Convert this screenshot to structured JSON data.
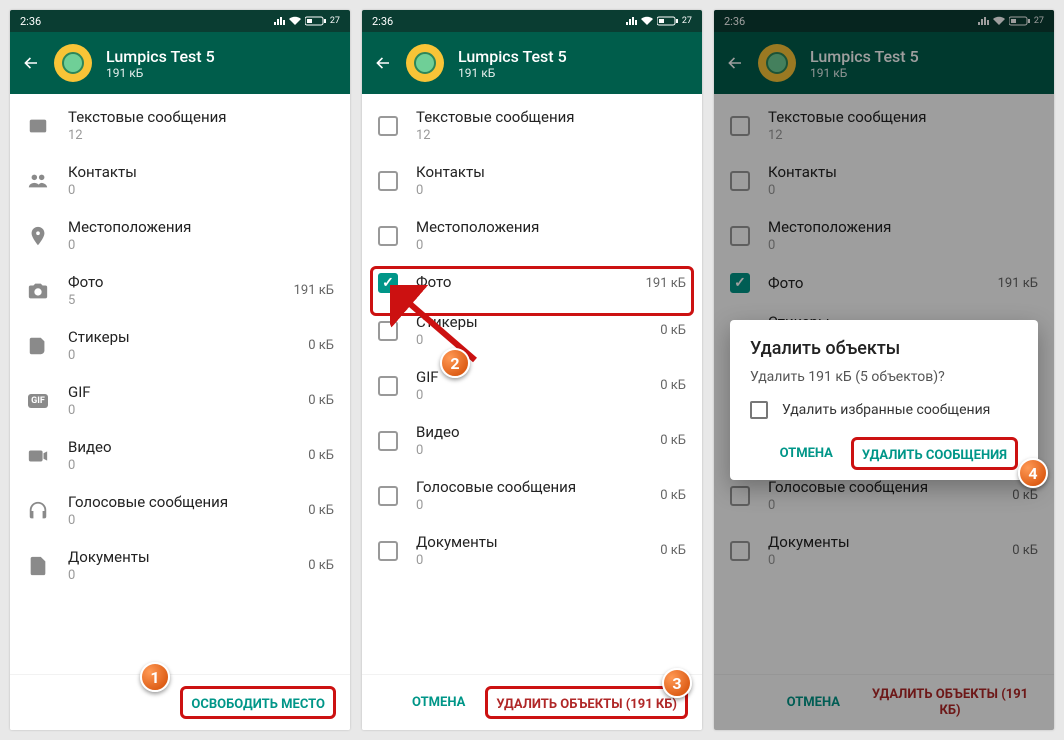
{
  "status": {
    "time": "2:36",
    "battery": "27"
  },
  "header": {
    "title": "Lumpics Test 5",
    "subtitle": "191 кБ"
  },
  "items": [
    {
      "label": "Текстовые сообщения",
      "count": "12",
      "size": ""
    },
    {
      "label": "Контакты",
      "count": "0",
      "size": ""
    },
    {
      "label": "Местоположения",
      "count": "0",
      "size": ""
    },
    {
      "label": "Фото",
      "count": "5",
      "size": "191 кБ"
    },
    {
      "label": "Стикеры",
      "count": "0",
      "size": "0 кБ"
    },
    {
      "label": "GIF",
      "count": "0",
      "size": "0 кБ"
    },
    {
      "label": "Видео",
      "count": "0",
      "size": "0 кБ"
    },
    {
      "label": "Голосовые сообщения",
      "count": "0",
      "size": "0 кБ"
    },
    {
      "label": "Документы",
      "count": "0",
      "size": "0 кБ"
    }
  ],
  "items2_count": [
    "12",
    "0",
    "0",
    "",
    "0",
    "0",
    "0",
    "0",
    "0"
  ],
  "buttons": {
    "free_space": "ОСВОБОДИТЬ МЕСТО",
    "cancel": "ОТМЕНА",
    "delete_objects": "УДАЛИТЬ ОБЪЕКТЫ (191 КБ)",
    "delete_messages": "УДАЛИТЬ СООБЩЕНИЯ"
  },
  "dialog": {
    "title": "Удалить объекты",
    "message": "Удалить 191 кБ (5 объектов)?",
    "checkbox_label": "Удалить избранные сообщения"
  },
  "callouts": {
    "c1": "1",
    "c2": "2",
    "c3": "3",
    "c4": "4"
  }
}
